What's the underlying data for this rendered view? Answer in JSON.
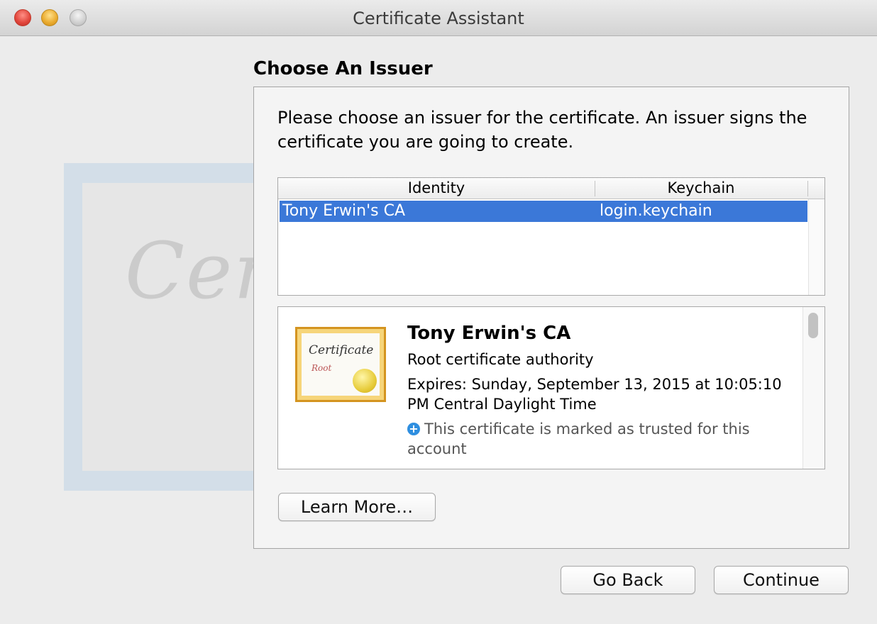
{
  "window": {
    "title": "Certificate Assistant"
  },
  "background": {
    "watermark_text": "Certif"
  },
  "page": {
    "heading": "Choose An Issuer",
    "instructions": "Please choose an issuer for the certificate. An issuer signs the certificate you are going to create."
  },
  "table": {
    "columns": [
      "Identity",
      "Keychain"
    ],
    "rows": [
      {
        "identity": "Tony Erwin's CA",
        "keychain": "login.keychain",
        "selected": true
      }
    ]
  },
  "details": {
    "icon": {
      "word": "Certificate",
      "sub": "Root"
    },
    "name": "Tony Erwin's CA",
    "type": "Root certificate authority",
    "expires": "Expires: Sunday, September 13, 2015 at 10:05:10 PM Central Daylight Time",
    "trust": "This certificate is marked as trusted for this account"
  },
  "buttons": {
    "learn_more": "Learn More…",
    "go_back": "Go Back",
    "continue": "Continue"
  },
  "colors": {
    "selection": "#3b78d8",
    "trust_icon": "#2f8fe0"
  }
}
